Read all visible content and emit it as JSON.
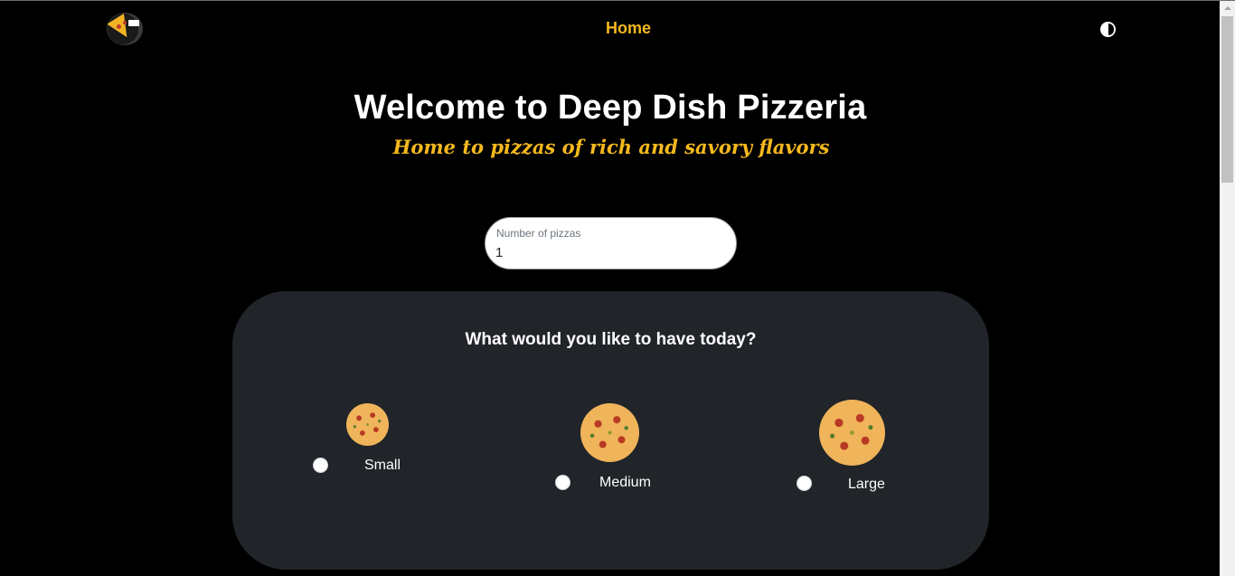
{
  "nav": {
    "home_label": "Home",
    "logo_icon": "pizza-slice-logo-icon",
    "theme_icon": "contrast-half-circle-icon"
  },
  "hero": {
    "title": "Welcome to Deep Dish Pizzeria",
    "subtitle": "Home to pizzas of rich and savory flavors"
  },
  "quantity": {
    "label": "Number of pizzas",
    "value": "1"
  },
  "card": {
    "question": "What would you like to have today?",
    "options": [
      {
        "label": "Small",
        "image": "small-pizza-image",
        "selected": false
      },
      {
        "label": "Medium",
        "image": "medium-pizza-image",
        "selected": false
      },
      {
        "label": "Large",
        "image": "large-pizza-image",
        "selected": false
      }
    ]
  },
  "colors": {
    "accent": "#f5b81d",
    "background": "#000000",
    "card": "#212429"
  }
}
